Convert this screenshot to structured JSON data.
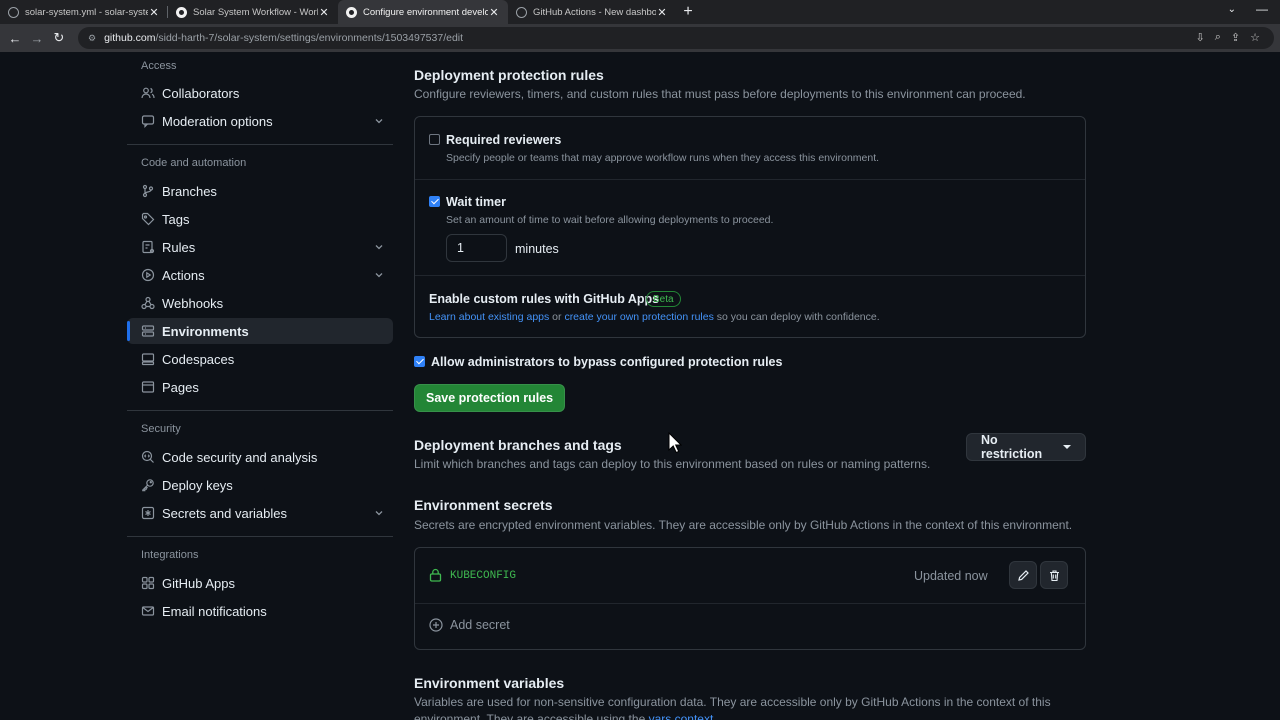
{
  "browser": {
    "tabs": [
      {
        "title": "solar-system.yml - solar-system",
        "icon": "ring-icon"
      },
      {
        "title": "Solar System Workflow - Workflo",
        "icon": "github-icon"
      },
      {
        "title": "Configure environment develop",
        "icon": "github-icon",
        "active": true
      },
      {
        "title": "GitHub Actions - New dashboard",
        "icon": "ring-icon"
      }
    ],
    "url_host": "github.com",
    "url_path": "/sidd-harth-7/solar-system/settings/environments/1503497537/edit"
  },
  "sidebar": {
    "access_title": "Access",
    "collaborators": "Collaborators",
    "moderation": "Moderation options",
    "code_title": "Code and automation",
    "branches": "Branches",
    "tags": "Tags",
    "rules": "Rules",
    "actions": "Actions",
    "webhooks": "Webhooks",
    "environments": "Environments",
    "codespaces": "Codespaces",
    "pages": "Pages",
    "security_title": "Security",
    "code_security": "Code security and analysis",
    "deploy_keys": "Deploy keys",
    "secrets": "Secrets and variables",
    "integrations_title": "Integrations",
    "github_apps": "GitHub Apps",
    "email": "Email notifications"
  },
  "protection": {
    "title": "Deployment protection rules",
    "desc": "Configure reviewers, timers, and custom rules that must pass before deployments to this environment can proceed.",
    "reviewers_label": "Required reviewers",
    "reviewers_desc": "Specify people or teams that may approve workflow runs when they access this environment.",
    "reviewers_checked": false,
    "timer_label": "Wait timer",
    "timer_desc": "Set an amount of time to wait before allowing deployments to proceed.",
    "timer_checked": true,
    "timer_value": "1",
    "timer_unit": "minutes",
    "custom_title": "Enable custom rules with GitHub Apps",
    "beta": "Beta",
    "custom_link1": "Learn about existing apps",
    "custom_or": " or ",
    "custom_link2": "create your own protection rules",
    "custom_tail": " so you can deploy with confidence.",
    "bypass_label": "Allow administrators to bypass configured protection rules",
    "bypass_checked": true,
    "save_button": "Save protection rules"
  },
  "branches_section": {
    "title": "Deployment branches and tags",
    "desc": "Limit which branches and tags can deploy to this environment based on rules or naming patterns.",
    "select": "No restriction"
  },
  "secrets_section": {
    "title": "Environment secrets",
    "desc": "Secrets are encrypted environment variables. They are accessible only by GitHub Actions in the context of this environment.",
    "secret_name": "KUBECONFIG",
    "updated": "Updated now",
    "add": "Add secret"
  },
  "variables_section": {
    "title": "Environment variables",
    "desc1": "Variables are used for non-sensitive configuration data. They are accessible only by GitHub Actions in the context of this",
    "desc2": "environment. They are accessible using the",
    "desc2_link": "vars context"
  },
  "colors": {
    "accent": "#2f81f7",
    "primary_button": "#238636",
    "secret_green": "#3fb950",
    "background": "#0d1117"
  }
}
